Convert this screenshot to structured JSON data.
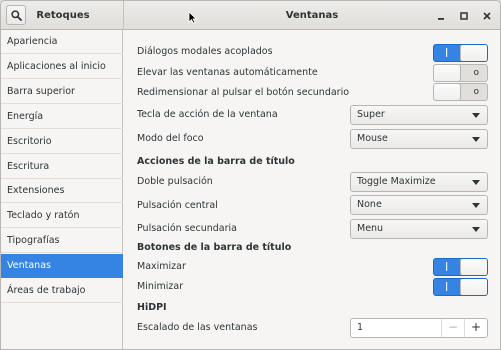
{
  "header": {
    "app_title": "Retoques",
    "window_title": "Ventanas",
    "controls": {
      "minimize_icon": "minimize-icon",
      "maximize_icon": "maximize-icon",
      "close_icon": "close-icon"
    }
  },
  "sidebar": {
    "items": [
      {
        "label": "Apariencia",
        "selected": false
      },
      {
        "label": "Aplicaciones al inicio",
        "selected": false
      },
      {
        "label": "Barra superior",
        "selected": false
      },
      {
        "label": "Energía",
        "selected": false
      },
      {
        "label": "Escritorio",
        "selected": false
      },
      {
        "label": "Escritura",
        "selected": false
      },
      {
        "label": "Extensiones",
        "selected": false
      },
      {
        "label": "Teclado y ratón",
        "selected": false
      },
      {
        "label": "Tipografías",
        "selected": false
      },
      {
        "label": "Ventanas",
        "selected": true
      },
      {
        "label": "Áreas de trabajo",
        "selected": false
      }
    ]
  },
  "settings": {
    "attached_modals": {
      "label": "Diálogos modales acoplados",
      "on": true
    },
    "auto_raise": {
      "label": "Elevar las ventanas automáticamente",
      "on": false
    },
    "resize_secondary": {
      "label": "Redimensionar al pulsar el botón secundario",
      "on": false
    },
    "action_key": {
      "label": "Tecla de acción de la ventana",
      "value": "Super"
    },
    "focus_mode": {
      "label": "Modo del foco",
      "value": "Mouse"
    },
    "titlebar_actions": {
      "heading": "Acciones de la barra de título",
      "double_click": {
        "label": "Doble pulsación",
        "value": "Toggle Maximize"
      },
      "middle_click": {
        "label": "Pulsación central",
        "value": "None"
      },
      "secondary_click": {
        "label": "Pulsación secundaria",
        "value": "Menu"
      }
    },
    "titlebar_buttons": {
      "heading": "Botones de la barra de título",
      "maximize": {
        "label": "Maximizar",
        "on": true
      },
      "minimize": {
        "label": "Minimizar",
        "on": true
      }
    },
    "hidpi": {
      "heading": "HiDPI",
      "scaling": {
        "label": "Escalado de las ventanas",
        "value": "1",
        "minus": "−",
        "plus": "+"
      }
    }
  },
  "switch_marks": {
    "on": "|",
    "off": "o"
  },
  "colors": {
    "accent": "#3584e4",
    "background": "#f6f5f4",
    "text": "#2e3436"
  }
}
